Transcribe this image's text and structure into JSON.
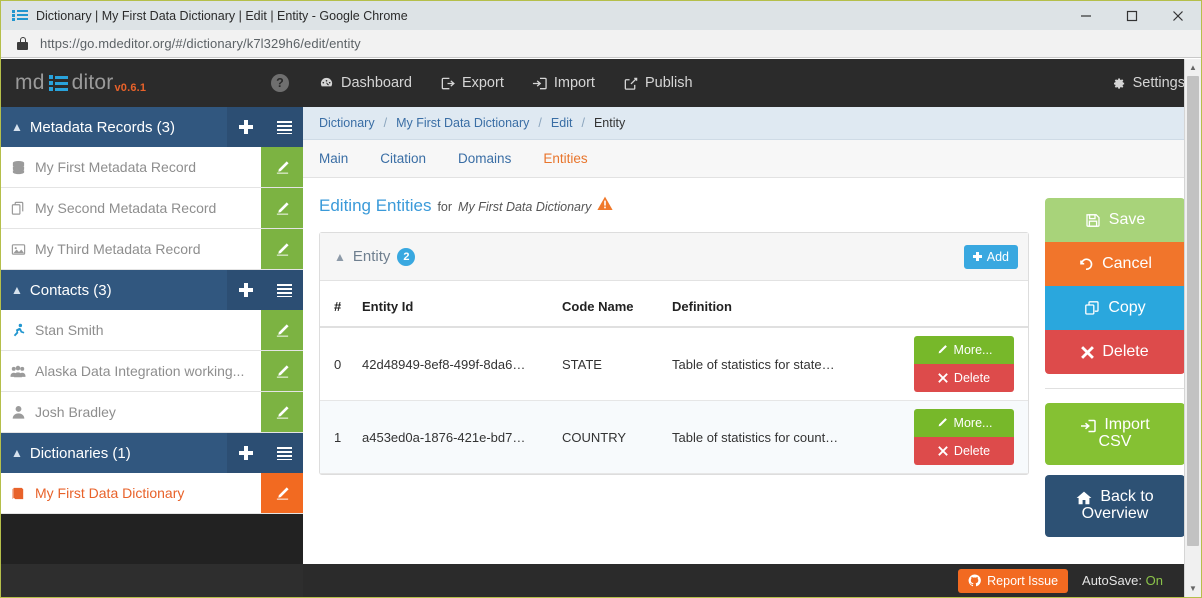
{
  "browser": {
    "tab_title": "Dictionary | My First Data Dictionary | Edit | Entity - Google Chrome",
    "favicon": "list-icon",
    "url": "https://go.mdeditor.org/#/dictionary/k7l329h6/edit/entity",
    "lock_icon": "lock-icon",
    "window_controls": {
      "minimize": "minimize-icon",
      "maximize": "maximize-icon",
      "close": "close-icon"
    }
  },
  "sidebar": {
    "brand": {
      "prefix": "md",
      "suffix": "ditor",
      "version": "v0.6.1",
      "help_icon": "question-mark-icon"
    },
    "groups": [
      {
        "title": "Metadata Records (3)",
        "caret": "chevron-up-icon",
        "add_icon": "plus-icon",
        "list_icon": "list-icon",
        "items": [
          {
            "label": "My First Metadata Record",
            "icon": "database-icon",
            "edit_icon": "pencil-icon",
            "active": false
          },
          {
            "label": "My Second Metadata Record",
            "icon": "copy-icon",
            "edit_icon": "pencil-icon",
            "active": false
          },
          {
            "label": "My Third Metadata Record",
            "icon": "image-icon",
            "edit_icon": "pencil-icon",
            "active": false
          }
        ]
      },
      {
        "title": "Contacts (3)",
        "caret": "chevron-up-icon",
        "add_icon": "plus-icon",
        "list_icon": "list-icon",
        "items": [
          {
            "label": "Stan Smith",
            "icon": "person-running-icon",
            "edit_icon": "pencil-icon",
            "active": false
          },
          {
            "label": "Alaska Data Integration working...",
            "icon": "group-icon",
            "edit_icon": "pencil-icon",
            "active": false
          },
          {
            "label": "Josh Bradley",
            "icon": "person-icon",
            "edit_icon": "pencil-icon",
            "active": false
          }
        ]
      },
      {
        "title": "Dictionaries (1)",
        "caret": "chevron-up-icon",
        "add_icon": "plus-icon",
        "list_icon": "list-icon",
        "items": [
          {
            "label": "My First Data Dictionary",
            "icon": "book-icon",
            "edit_icon": "pencil-icon",
            "active": true
          }
        ]
      }
    ]
  },
  "topnav": {
    "items": [
      {
        "label": "Dashboard",
        "icon": "dashboard-icon"
      },
      {
        "label": "Export",
        "icon": "export-icon"
      },
      {
        "label": "Import",
        "icon": "import-icon"
      },
      {
        "label": "Publish",
        "icon": "publish-icon"
      }
    ],
    "settings": {
      "label": "Settings",
      "icon": "gear-icon"
    }
  },
  "breadcrumb": [
    {
      "label": "Dictionary",
      "current": false
    },
    {
      "label": "My First Data Dictionary",
      "current": false
    },
    {
      "label": "Edit",
      "current": false
    },
    {
      "label": "Entity",
      "current": true
    }
  ],
  "tabs": [
    {
      "label": "Main",
      "active": false
    },
    {
      "label": "Citation",
      "active": false
    },
    {
      "label": "Domains",
      "active": false
    },
    {
      "label": "Entities",
      "active": true
    }
  ],
  "page": {
    "heading": "Editing Entities",
    "heading_for": "for",
    "heading_target": "My First Data Dictionary",
    "warning_icon": "warning-triangle-icon"
  },
  "entity_panel": {
    "caret": "chevron-up-icon",
    "title": "Entity",
    "count": "2",
    "add_label": "Add",
    "columns": [
      "#",
      "Entity Id",
      "Code Name",
      "Definition"
    ],
    "rows": [
      {
        "num": "0",
        "entity_id": "42d48949-8ef8-499f-8da6…",
        "code_name": "STATE",
        "definition": "Table of statistics for state…",
        "more_label": "More...",
        "delete_label": "Delete"
      },
      {
        "num": "1",
        "entity_id": "a453ed0a-1876-421e-bd7…",
        "code_name": "COUNTRY",
        "definition": "Table of statistics for count…",
        "more_label": "More...",
        "delete_label": "Delete"
      }
    ]
  },
  "rail": {
    "primary": [
      {
        "label": "Save",
        "icon": "floppy-disk-icon",
        "color": "#a8d37a"
      },
      {
        "label": "Cancel",
        "icon": "undo-icon",
        "color": "#f1752b"
      },
      {
        "label": "Copy",
        "icon": "copy-icon",
        "color": "#2aa7dd"
      },
      {
        "label": "Delete",
        "icon": "x-icon",
        "color": "#dd4b4b"
      }
    ],
    "import_csv": {
      "line1": "Import",
      "line2": "CSV",
      "icon": "import-icon",
      "color": "#85c133"
    },
    "back_overview": {
      "line1": "Back to",
      "line2": "Overview",
      "icon": "home-icon",
      "color": "#2d5174"
    }
  },
  "footer": {
    "report_label": "Report Issue",
    "report_icon": "github-icon",
    "autosave_label": "AutoSave:",
    "autosave_value": "On"
  }
}
